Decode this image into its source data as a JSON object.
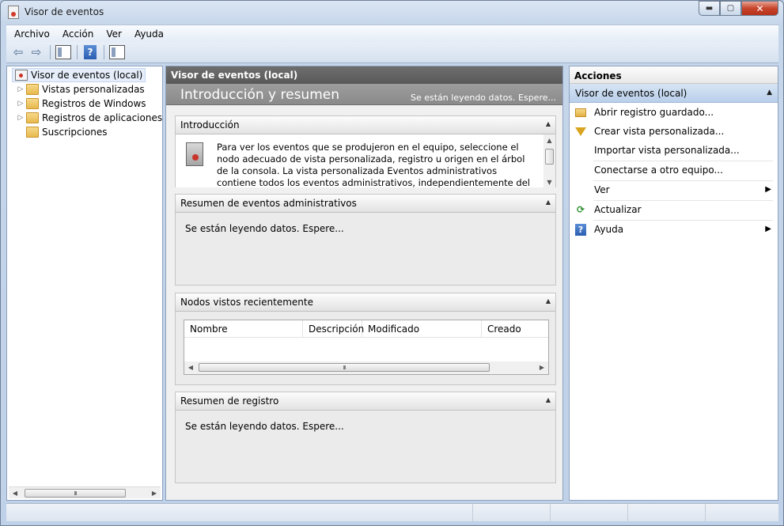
{
  "window": {
    "title": "Visor de eventos",
    "controls": {
      "minimize": "▬",
      "maximize": "▢",
      "close": "✕"
    }
  },
  "menu": [
    "Archivo",
    "Acción",
    "Ver",
    "Ayuda"
  ],
  "toolbar": {
    "back_icon": "⇦",
    "forward_icon": "⇨",
    "help_label": "?"
  },
  "tree": {
    "root": "Visor de eventos (local)",
    "items": [
      "Vistas personalizadas",
      "Registros de Windows",
      "Registros de aplicaciones y s",
      "Suscripciones"
    ],
    "scroll_label": "III"
  },
  "center": {
    "header": "Visor de eventos (local)",
    "intro_title": "Introducción y resumen",
    "intro_status": "Se están leyendo datos. Espere...",
    "sections": {
      "intro": {
        "title": "Introducción",
        "text": "Para ver los eventos que se produjeron en el equipo, seleccione el nodo adecuado de vista personalizada, registro u origen en el árbol de la consola. La vista personalizada Eventos administrativos contiene todos los eventos administrativos, independientemente del origen. A continuación"
      },
      "admin_summary": {
        "title": "Resumen de eventos administrativos",
        "status": "Se están leyendo datos. Espere..."
      },
      "recent_nodes": {
        "title": "Nodos vistos recientemente",
        "columns": [
          "Nombre",
          "Descripción",
          "Modificado",
          "Creado"
        ],
        "scroll_label": "III"
      },
      "log_summary": {
        "title": "Resumen de registro",
        "status": "Se están leyendo datos. Espere..."
      }
    }
  },
  "actions": {
    "header": "Acciones",
    "subheader": "Visor de eventos (local)",
    "items": [
      {
        "label": "Abrir registro guardado...",
        "icon": "folder-open-icon"
      },
      {
        "label": "Crear vista personalizada...",
        "icon": "filter-icon"
      },
      {
        "label": "Importar vista personalizada...",
        "icon": ""
      },
      {
        "label": "Conectarse a otro equipo...",
        "icon": ""
      },
      {
        "label": "Ver",
        "icon": "",
        "submenu": true
      },
      {
        "label": "Actualizar",
        "icon": "refresh-icon"
      },
      {
        "label": "Ayuda",
        "icon": "help-icon",
        "submenu": true
      }
    ]
  },
  "colors": {
    "accent_blue": "#b9cfea",
    "header_gray": "#595959",
    "intro_gray": "#8a8a8a"
  }
}
